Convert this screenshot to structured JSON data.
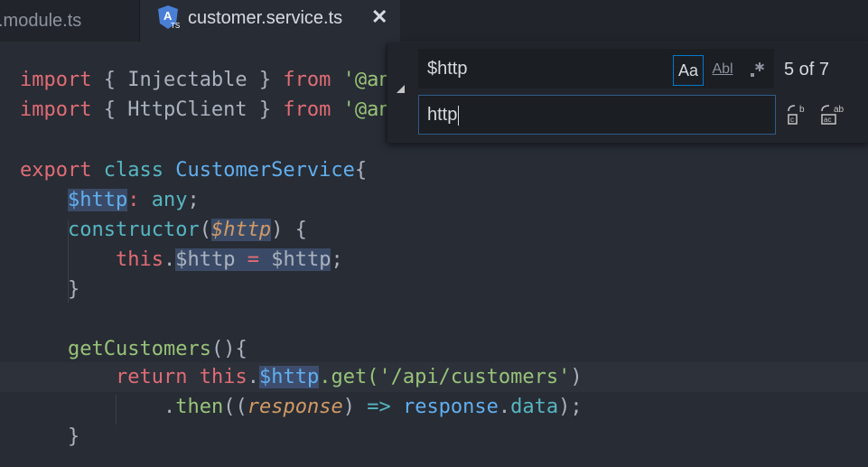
{
  "tabs": {
    "inactive_label": ".module.ts",
    "active_label": "customer.service.ts",
    "close_glyph": "✕",
    "active_icon": "angular-ts-icon"
  },
  "code": {
    "line1": {
      "kw": "import",
      "a": " { Injectable } ",
      "from": "from",
      "str": " '@an"
    },
    "line2": {
      "kw": "import",
      "a": " { HttpClient } ",
      "from": "from",
      "str": " '@an"
    },
    "line4": {
      "export": "export",
      "class": "class",
      "name": "CustomerService",
      "brace": "{"
    },
    "line5": {
      "prop": "$http",
      "colon": ": ",
      "type": "any",
      "semi": ";"
    },
    "line6": {
      "fn": "constructor",
      "open": "(",
      "param": "$http",
      "close": ")",
      "brace": " {"
    },
    "line7": {
      "this": "this",
      "dot": ".",
      "prop": "$http",
      "eq": " = ",
      "val": "$http",
      "semi": ";"
    },
    "line8": {
      "brace": "}"
    },
    "line10": {
      "fn": "getCustomers",
      "paren": "(){"
    },
    "line11": {
      "ret": "return",
      "this": " this",
      "dot": ".",
      "prop": "$http",
      "get": ".get(",
      "str": "'/api/customers'",
      "close": ")"
    },
    "line12": {
      "dot": ".",
      "then": "then",
      "open": "((",
      "param": "response",
      "close": ") ",
      "arrow": "=>",
      "resp": " response",
      "dot2": ".",
      "data": "data",
      "end": ");"
    },
    "line13": {
      "brace": "}"
    }
  },
  "find": {
    "search_value": "$http",
    "match_case_label": "Aa",
    "whole_word_label": "Abl",
    "regex_label": ".*",
    "match_count": "5 of 7",
    "replace_value": "http"
  },
  "colors": {
    "editor_bg": "#282c34",
    "accent": "#007acc",
    "keyword": "#e06c75",
    "string": "#98c379",
    "class": "#61afef"
  }
}
